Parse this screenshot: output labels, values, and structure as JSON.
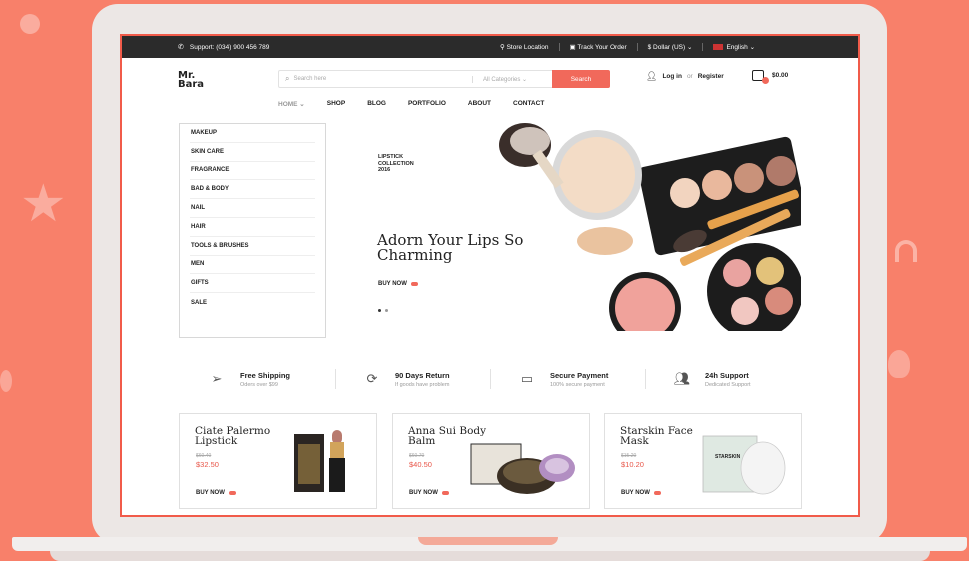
{
  "topbar": {
    "support": "Support: (034) 900 456 789",
    "store_location": "Store Location",
    "track_order": "Track Your Order",
    "currency": "$ Dollar (US)",
    "language": "English"
  },
  "logo": {
    "line1": "Mr.",
    "line2": "Bara"
  },
  "search": {
    "placeholder": "Search here",
    "category": "All Categories",
    "button": "Search"
  },
  "account": {
    "login": "Log in",
    "or": "or",
    "register": "Register"
  },
  "cart": {
    "total": "$0.00"
  },
  "nav": [
    "HOME",
    "SHOP",
    "BLOG",
    "PORTFOLIO",
    "ABOUT",
    "CONTACT"
  ],
  "categories": [
    "MAKEUP",
    "SKIN CARE",
    "FRAGRANCE",
    "BAD & BODY",
    "NAIL",
    "HAIR",
    "TOOLS & BRUSHES",
    "MEN",
    "GIFTS",
    "SALE"
  ],
  "hero": {
    "small": [
      "LIPSTICK",
      "COLLECTION",
      "2016"
    ],
    "title_line1": "Adorn Your Lips So",
    "title_line2": "Charming",
    "cta": "BUY NOW"
  },
  "features": [
    {
      "title": "Free Shipping",
      "sub": "Oders over $99",
      "icon": "paper-plane-icon"
    },
    {
      "title": "90 Days Return",
      "sub": "If goods have problem",
      "icon": "refresh-icon"
    },
    {
      "title": "Secure Payment",
      "sub": "100% secure payment",
      "icon": "credit-card-icon"
    },
    {
      "title": "24h Support",
      "sub": "Dedicated Support",
      "icon": "users-icon"
    }
  ],
  "products": [
    {
      "line1": "Ciate Palermo",
      "line2": "Lipstick",
      "old": "$60.40",
      "price": "$32.50",
      "cta": "BUY NOW"
    },
    {
      "line1": "Anna Sui Body",
      "line2": "Balm",
      "old": "$60.70",
      "price": "$40.50",
      "cta": "BUY NOW"
    },
    {
      "line1": "Starskin Face",
      "line2": "Mask",
      "old": "$15.20",
      "price": "$10.20",
      "cta": "BUY NOW"
    }
  ],
  "mask_label": "STARSKIN",
  "colors": {
    "accent": "#f1695b",
    "background": "#f8806a",
    "topbar": "#2b2b2b",
    "settings_tab": "#7cb342"
  }
}
